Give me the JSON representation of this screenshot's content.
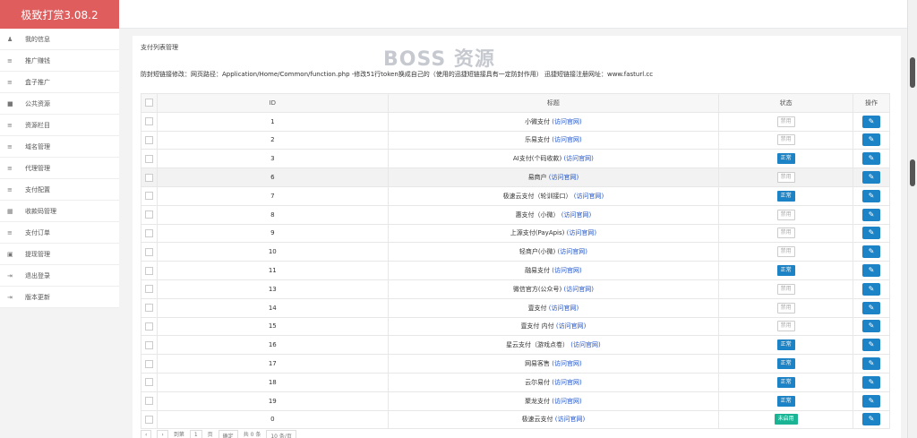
{
  "app": {
    "title": "极致打赏3.08.2"
  },
  "sidebar": {
    "items": [
      {
        "label": "我的信息",
        "icon": "user-icon",
        "glyph": "♟"
      },
      {
        "label": "推广赚钱",
        "icon": "list-icon",
        "glyph": "≡"
      },
      {
        "label": "盒子推广",
        "icon": "list-icon",
        "glyph": "≡"
      },
      {
        "label": "公共资源",
        "icon": "video-icon",
        "glyph": "■"
      },
      {
        "label": "资源栏目",
        "icon": "list-icon",
        "glyph": "≡"
      },
      {
        "label": "域名管理",
        "icon": "list-icon",
        "glyph": "≡"
      },
      {
        "label": "代理管理",
        "icon": "list-icon",
        "glyph": "≡"
      },
      {
        "label": "支付配置",
        "icon": "list-icon",
        "glyph": "≡"
      },
      {
        "label": "收款码管理",
        "icon": "qrcode-icon",
        "glyph": "▦"
      },
      {
        "label": "支付订单",
        "icon": "list-icon",
        "glyph": "≡"
      },
      {
        "label": "提现管理",
        "icon": "money-icon",
        "glyph": "▣"
      },
      {
        "label": "退出登录",
        "icon": "logout-icon",
        "glyph": "⇥"
      },
      {
        "label": "版本更新",
        "icon": "update-icon",
        "glyph": "⇥"
      }
    ]
  },
  "main": {
    "title": "支付列表管理",
    "watermark": "BOSS 资源",
    "notice": "防封短链接修改：网页路径：Application/Home/Common/function.php  -修改51行token换成自己的（使用的迅捷短链接具有一定防封作用）  迅捷短链接注册网址：www.fasturl.cc",
    "columns": {
      "id": "ID",
      "title": "标题",
      "status": "状态",
      "action": "操作"
    },
    "visit_label": "(访问官网)",
    "rows": [
      {
        "id": "1",
        "title": "小微支付",
        "status": "禁用",
        "type": "off"
      },
      {
        "id": "2",
        "title": "乐易支付",
        "status": "禁用",
        "type": "off"
      },
      {
        "id": "3",
        "title": "AI支付(个码收款)",
        "status": "正常",
        "type": "on"
      },
      {
        "id": "6",
        "title": "易商户",
        "status": "禁用",
        "type": "off"
      },
      {
        "id": "7",
        "title": "极速云支付（轮训接口）",
        "status": "正常",
        "type": "on"
      },
      {
        "id": "8",
        "title": "惠支付（小微）",
        "status": "禁用",
        "type": "off"
      },
      {
        "id": "9",
        "title": "上源支付(PayApis)",
        "status": "禁用",
        "type": "off"
      },
      {
        "id": "10",
        "title": "轻商户(小微)",
        "status": "禁用",
        "type": "off"
      },
      {
        "id": "11",
        "title": "融易支付",
        "status": "正常",
        "type": "on"
      },
      {
        "id": "13",
        "title": "微信官方(公众号)",
        "status": "禁用",
        "type": "off"
      },
      {
        "id": "14",
        "title": "壹支付",
        "status": "禁用",
        "type": "off"
      },
      {
        "id": "15",
        "title": "壹支付 内付",
        "status": "禁用",
        "type": "off"
      },
      {
        "id": "16",
        "title": "星云支付（游戏点卷）",
        "status": "正常",
        "type": "on"
      },
      {
        "id": "17",
        "title": "网易客售",
        "status": "正常",
        "type": "on"
      },
      {
        "id": "18",
        "title": "云尔易付",
        "status": "正常",
        "type": "on"
      },
      {
        "id": "19",
        "title": "聚龙支付",
        "status": "正常",
        "type": "on"
      },
      {
        "id": "0",
        "title": "极速云支付",
        "status": "未启用",
        "type": "un"
      }
    ]
  },
  "pager": {
    "prev": "‹",
    "next": "›",
    "to": "到第",
    "page": "1",
    "unit": "页",
    "go": "确定",
    "total": "共 0 条",
    "per_page": "10 条/页"
  },
  "colors": {
    "brand": "#e05d5d",
    "accent": "#1c84c6",
    "green": "#1ab394"
  }
}
